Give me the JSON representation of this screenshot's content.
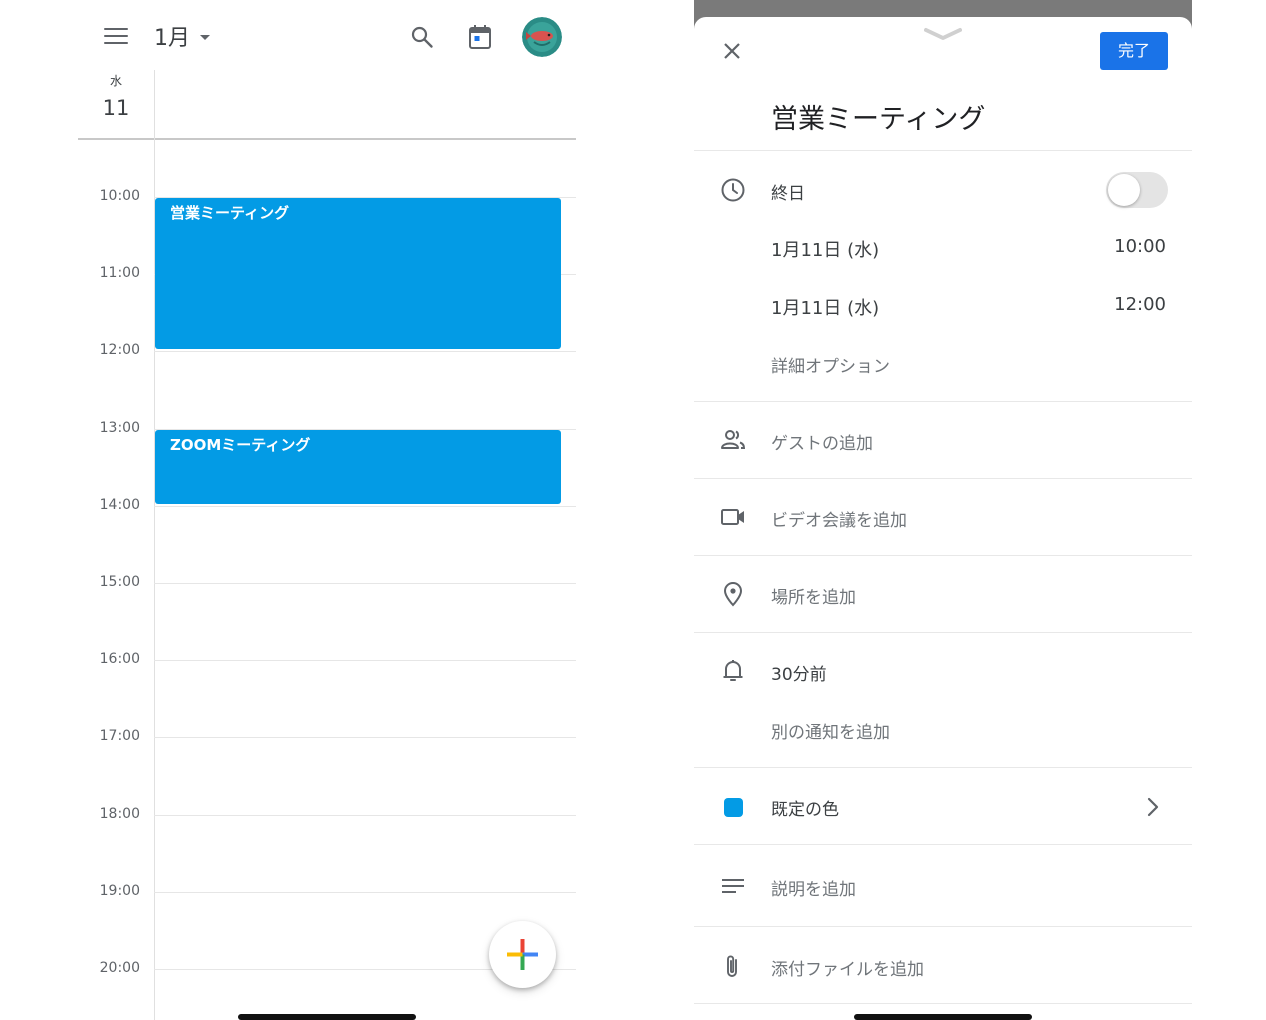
{
  "calendar": {
    "month_label": "1月",
    "weekday": "水",
    "day_number": "11",
    "hours": [
      "10:00",
      "11:00",
      "12:00",
      "13:00",
      "14:00",
      "15:00",
      "16:00",
      "17:00",
      "18:00",
      "19:00",
      "20:00"
    ],
    "events": [
      {
        "title": "営業ミーティング",
        "start": "10:00",
        "end": "12:00"
      },
      {
        "title": "ZOOMミーティング",
        "start": "13:00",
        "end": "14:00"
      }
    ],
    "event_color": "#039be5",
    "icons": {
      "menu": "menu-icon",
      "search": "search-icon",
      "today": "calendar-today-icon",
      "avatar": "avatar",
      "fab": "plus-icon"
    }
  },
  "editor": {
    "done_label": "完了",
    "title": "営業ミーティング",
    "all_day_label": "終日",
    "all_day_on": false,
    "start_date": "1月11日 (水)",
    "start_time": "10:00",
    "end_date": "1月11日 (水)",
    "end_time": "12:00",
    "more_options": "詳細オプション",
    "add_guests": "ゲストの追加",
    "add_video": "ビデオ会議を追加",
    "add_location": "場所を追加",
    "notification": "30分前",
    "add_notification": "別の通知を追加",
    "color_label": "既定の色",
    "color_value": "#039be5",
    "add_description": "説明を追加",
    "add_attachment": "添付ファイルを追加",
    "accent": "#1a73e8",
    "icons": [
      "close-icon",
      "clock-icon",
      "people-icon",
      "video-icon",
      "location-pin-icon",
      "bell-icon",
      "color-swatch",
      "notes-icon",
      "paperclip-icon",
      "chevron-right-icon"
    ]
  }
}
